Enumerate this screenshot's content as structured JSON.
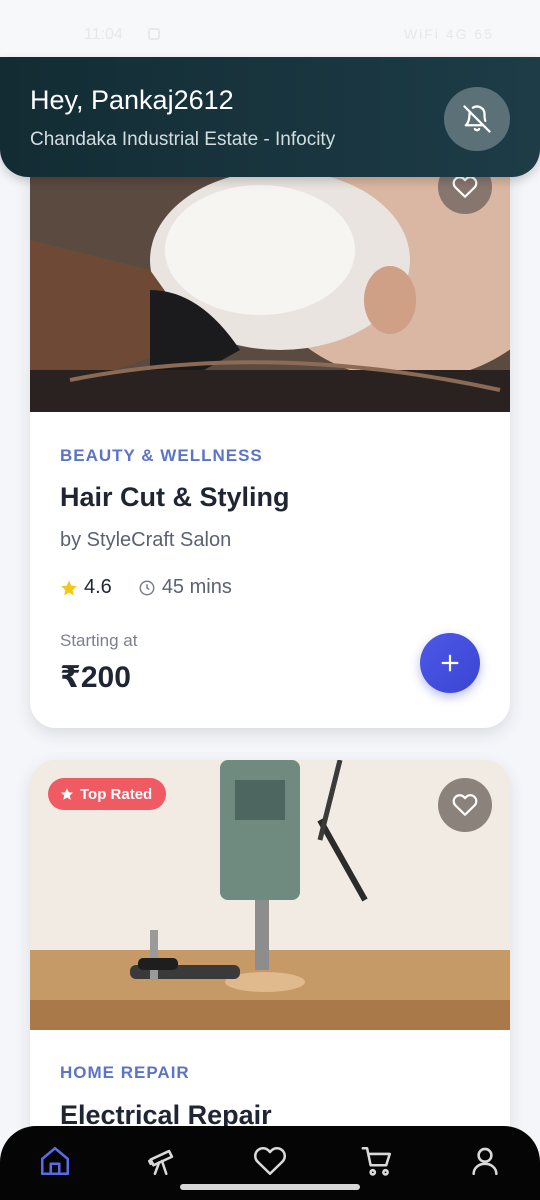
{
  "status_bar": {
    "time": "11:04",
    "right": "WiFi 4G 65"
  },
  "header": {
    "greeting": "Hey, Pankaj2612",
    "location": "Chandaka Industrial Estate - Infocity"
  },
  "services": [
    {
      "category": "BEAUTY & WELLNESS",
      "title": "Hair Cut & Styling",
      "provider": "by StyleCraft Salon",
      "rating": "4.6",
      "duration": "45 mins",
      "starting_label": "Starting at",
      "price": "₹200",
      "image_desc": "hair-wash-photo"
    },
    {
      "badge": "Top Rated",
      "category": "HOME REPAIR",
      "title": "Electrical Repair",
      "image_desc": "drill-press-photo"
    }
  ],
  "nav": [
    "home-icon",
    "telescope-icon",
    "heart-icon",
    "cart-icon",
    "user-icon"
  ],
  "colors": {
    "accent": "#4d58e6",
    "header": "#1d3c47",
    "category": "#5b74c7",
    "badge": "#f05a63",
    "nav_active": "#5b6be6"
  }
}
